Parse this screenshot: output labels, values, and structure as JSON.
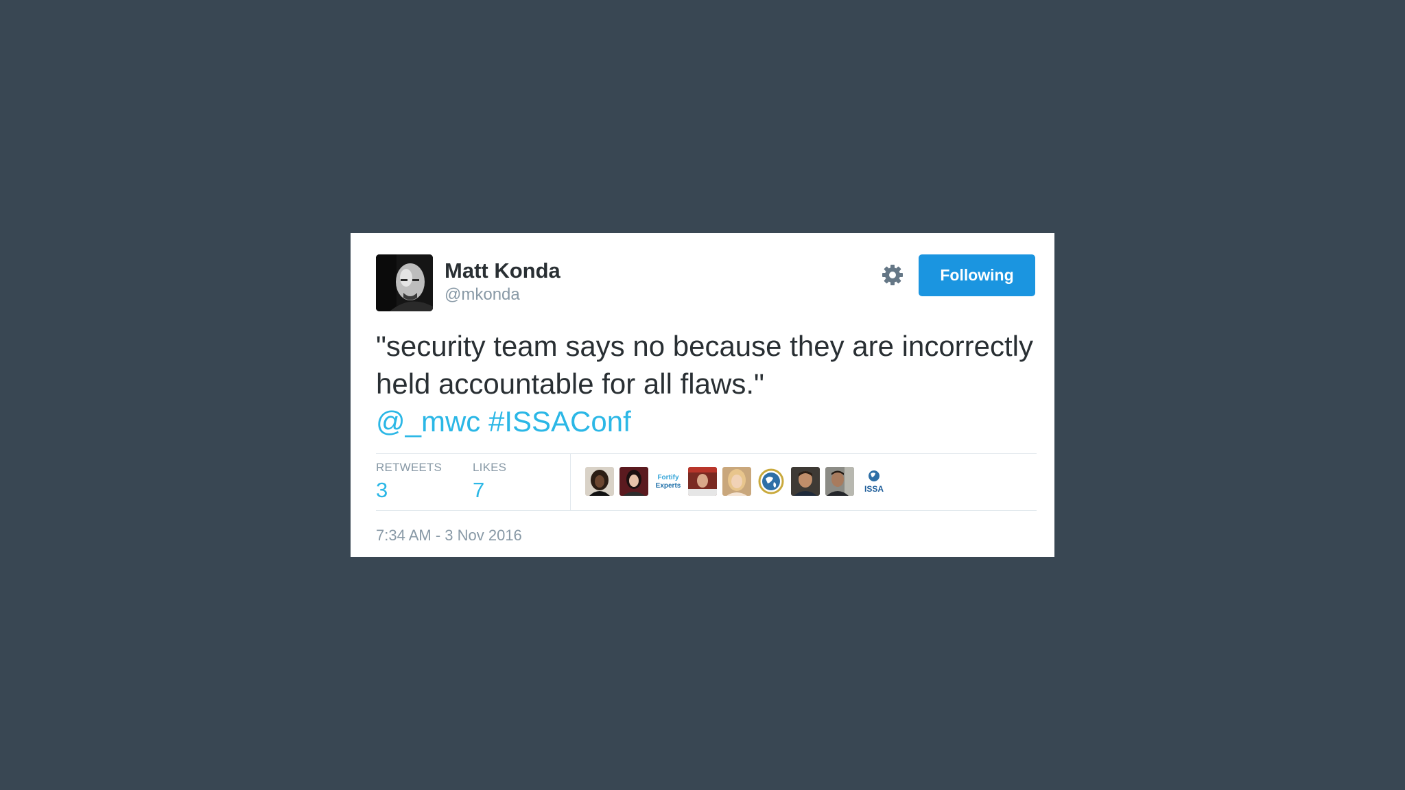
{
  "tweet": {
    "author": {
      "name": "Matt Konda",
      "handle": "@mkonda"
    },
    "follow_button_label": "Following",
    "text": "\"security team says no because they are incorrectly held accountable for all flaws.\"",
    "mention": "@_mwc",
    "hashtag": "#ISSAConf",
    "stats": {
      "retweets_label": "RETWEETS",
      "retweets_count": "3",
      "likes_label": "LIKES",
      "likes_count": "7"
    },
    "timestamp": "7:34 AM - 3 Nov 2016",
    "likers": [
      {
        "name": "liker-1",
        "icon": "avatar"
      },
      {
        "name": "liker-2",
        "icon": "avatar"
      },
      {
        "name": "liker-3",
        "icon": "fortify-experts-logo",
        "logo_text_top": "Fortify",
        "logo_text_bottom": "Experts"
      },
      {
        "name": "liker-4",
        "icon": "avatar"
      },
      {
        "name": "liker-5",
        "icon": "avatar"
      },
      {
        "name": "liker-6",
        "icon": "globe-logo"
      },
      {
        "name": "liker-7",
        "icon": "avatar"
      },
      {
        "name": "liker-8",
        "icon": "avatar"
      },
      {
        "name": "liker-9",
        "icon": "issa-logo",
        "logo_text": "ISSA"
      }
    ],
    "colors": {
      "background": "#394753",
      "link": "#2bb7e6",
      "button": "#1b95e0",
      "muted": "#8899a6",
      "text": "#292f33"
    }
  }
}
